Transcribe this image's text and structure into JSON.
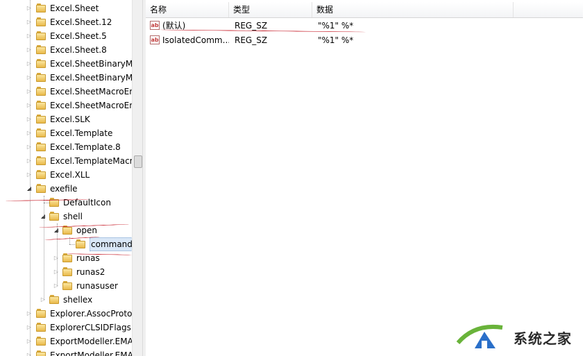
{
  "tree": {
    "items": [
      {
        "label": "Excel.Sheet",
        "depth": 0,
        "expander": "collapsed"
      },
      {
        "label": "Excel.Sheet.12",
        "depth": 0,
        "expander": "collapsed"
      },
      {
        "label": "Excel.Sheet.5",
        "depth": 0,
        "expander": "collapsed"
      },
      {
        "label": "Excel.Sheet.8",
        "depth": 0,
        "expander": "collapsed"
      },
      {
        "label": "Excel.SheetBinaryMa",
        "depth": 0,
        "expander": "collapsed"
      },
      {
        "label": "Excel.SheetBinaryMa",
        "depth": 0,
        "expander": "collapsed"
      },
      {
        "label": "Excel.SheetMacroEn",
        "depth": 0,
        "expander": "collapsed"
      },
      {
        "label": "Excel.SheetMacroEn",
        "depth": 0,
        "expander": "collapsed"
      },
      {
        "label": "Excel.SLK",
        "depth": 0,
        "expander": "collapsed"
      },
      {
        "label": "Excel.Template",
        "depth": 0,
        "expander": "collapsed"
      },
      {
        "label": "Excel.Template.8",
        "depth": 0,
        "expander": "collapsed"
      },
      {
        "label": "Excel.TemplateMacr",
        "depth": 0,
        "expander": "collapsed"
      },
      {
        "label": "Excel.XLL",
        "depth": 0,
        "expander": "collapsed"
      },
      {
        "label": "exefile",
        "depth": 0,
        "expander": "expanded"
      },
      {
        "label": "DefaultIcon",
        "depth": 1,
        "expander": "none"
      },
      {
        "label": "shell",
        "depth": 1,
        "expander": "expanded"
      },
      {
        "label": "open",
        "depth": 2,
        "expander": "expanded"
      },
      {
        "label": "command",
        "depth": 3,
        "expander": "none",
        "selected": true
      },
      {
        "label": "runas",
        "depth": 2,
        "expander": "collapsed"
      },
      {
        "label": "runas2",
        "depth": 2,
        "expander": "collapsed"
      },
      {
        "label": "runasuser",
        "depth": 2,
        "expander": "collapsed"
      },
      {
        "label": "shellex",
        "depth": 1,
        "expander": "collapsed"
      },
      {
        "label": "Explorer.AssocProto",
        "depth": 0,
        "expander": "collapsed"
      },
      {
        "label": "ExplorerCLSIDFlags",
        "depth": 0,
        "expander": "collapsed"
      },
      {
        "label": "ExportModeller.EMA",
        "depth": 0,
        "expander": "collapsed"
      },
      {
        "label": "ExportModeller.EMA",
        "depth": 0,
        "expander": "collapsed"
      }
    ]
  },
  "list": {
    "headers": {
      "name": "名称",
      "type": "类型",
      "data": "数据"
    },
    "rows": [
      {
        "name": "(默认)",
        "type": "REG_SZ",
        "data": "\"%1\" %*",
        "icon": "string-value-icon"
      },
      {
        "name": "IsolatedComm...",
        "type": "REG_SZ",
        "data": "\"%1\" %*",
        "icon": "string-value-icon"
      }
    ]
  },
  "icons": {
    "string_value": "ab"
  },
  "watermark": {
    "text": "系统之家"
  },
  "colors": {
    "annotation": "#c8242f",
    "selection": "#d9e7f7",
    "folder": "#f2c85b"
  }
}
